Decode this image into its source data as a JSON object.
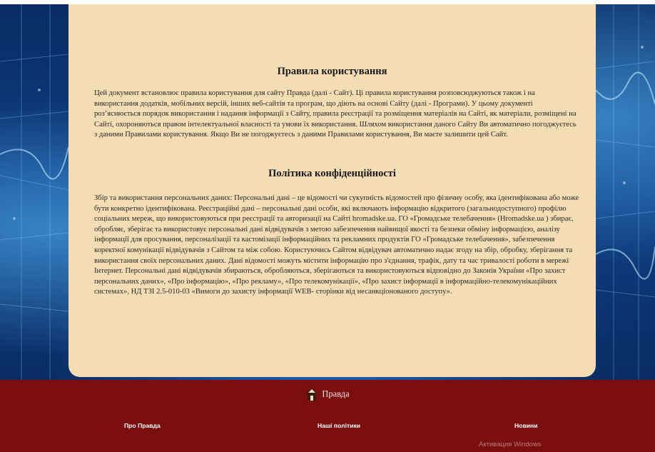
{
  "colors": {
    "panel": "#f4dcb4",
    "footer": "#7b0e0e",
    "background": "#0f3f86"
  },
  "rules": {
    "title": "Правила користування",
    "text": "Цей документ встановлює правила користування для сайту Правда (далі - Сайт). Ці правила користування розповсюджуються також і на використання додатків, мобільних версій, інших веб-сайтів та програм, що діють на основі Сайту (далі - Програми). У цьому документі роз’яснюється порядок використання і надання інформації з Сайту, правила реєстрації та розміщення матеріалів на Сайті, як матеріали, розміщені на Сайті, охороняються правом інтелектуальної власності та умови їх використання. Шляхом використання даного Сайту Ви автоматично погоджуєтесь з даними Правилами користування. Якщо Ви не погоджуєтесь з даними Правилами користування, Ви маєте залишити цей Сайт."
  },
  "policy": {
    "title": "Політика конфіденційності",
    "text": "Збір та використання персональних даних: Персональні дані – це відомості чи сукупність відомостей про фізичну особу, яка ідентифікована або може бути конкретно ідентифікована. Реєстраційні дані – персональні дані особи, які включають інформацію відкритого (загальнодоступного) профілю соціальних мереж, що використовуються при реєстрації та авторизації на Сайті hromadske.ua. ГО «Громадське телебачення» (Hromadske.ua ) збирає, обробляє, зберігає та використовує персональні дані відвідувачів з метою забезпечення найвищої якості та безпеки обміну інформацією, аналізу інформації для просування, персоналізації та кастомізації інформаційних та рекламних продуктів ГО «Громадське телебачення», забезпечення коректної комунікації відвідувачів з Сайтом та між собою. Користуючись Сайтом відвідувач автоматично надає згоду на збір, обробку, зберігання та використання своїх персональних даних. Дані відомості можуть містити інформацію про з'єднання, трафік, дату та час тривалості роботи в мережі Інтернет. Персональні дані відвідувачів збираються, обробляються, зберігаються та використовуються відповідно до Законів України «Про захист персональних даних», «Про інформацію», «Про рекламу», «Про телекомунікації», «Про захист інформації в інформаційно-телекомунікаційних системах», НД ТЗІ 2.5-010-03 «Вимоги до захисту інформації WEB- сторінки від несанкціонованого доступу»."
  },
  "footer": {
    "brand": "Правда",
    "brand_icon": "house-icon",
    "links": [
      "Про Правда",
      "Наші політики",
      "Новини"
    ]
  },
  "watermark": "Активация Windows"
}
